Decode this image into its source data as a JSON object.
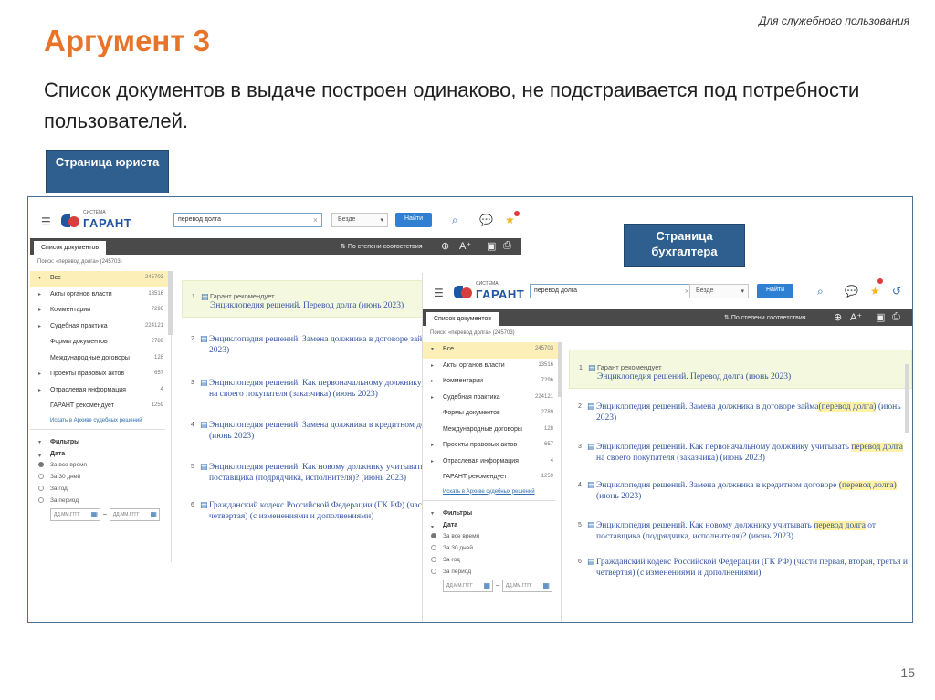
{
  "slide": {
    "confidential": "Для служебного пользования",
    "title": "Аргумент 3",
    "text": "Список документов в выдаче построен одинаково, не подстраивается под потребности пользователей.",
    "page_number": "15"
  },
  "labels": {
    "lawyer": "Страница юриста",
    "accountant": "Страница бухгалтера"
  },
  "app": {
    "logo_sub": "СИСТЕМА",
    "logo_text": "ГАРАНТ",
    "search_value": "перевод долга",
    "scope": "Везде",
    "find_button": "Найти",
    "tab": "Список документов",
    "sort": "По степени соответствия",
    "query": "Поиск: «перевод долга» (245703)",
    "icons": {
      "menu": "hamburger-icon",
      "search": "search-list-icon",
      "chat": "chat-icon",
      "favorite": "star-icon",
      "history": "history-icon",
      "zoom": "zoom-icon",
      "font": "font-size-icon",
      "save": "save-icon",
      "print": "print-icon"
    }
  },
  "sidebar": {
    "items": [
      {
        "label": "Все",
        "count": "245703",
        "selected": true,
        "caret": "▾"
      },
      {
        "label": "Акты органов власти",
        "count": "13516",
        "caret": "▸"
      },
      {
        "label": "Комментарии",
        "count": "7296",
        "caret": "▸"
      },
      {
        "label": "Судебная практика",
        "count": "224121",
        "caret": "▸"
      },
      {
        "label": "Формы документов",
        "count": "2789",
        "caret": ""
      },
      {
        "label": "Международные договоры",
        "count": "128",
        "caret": ""
      },
      {
        "label": "Проекты правовых актов",
        "count": "657",
        "caret": "▸"
      },
      {
        "label": "Отраслевая информация",
        "count": "4",
        "caret": "▸"
      },
      {
        "label": "ГАРАНТ рекомендует",
        "count": "1259",
        "caret": ""
      }
    ],
    "archive_link": "Искать в Архиве судебных решений",
    "filters": "Фильтры",
    "date": "Дата",
    "date_options": [
      "За все время",
      "За 30 дней",
      "За год",
      "За период"
    ],
    "date_placeholder": "ДД.ММ.ГГГГ"
  },
  "results": [
    {
      "n": "1",
      "recommend": "Гарант рекомендует",
      "title": [
        "Энциклопедия решений. Перевод долга (июнь 2023)"
      ]
    },
    {
      "n": "2",
      "title": [
        "Энциклопедия решений. Замена должника в договоре займа",
        {
          "hl": "(перевод долга)"
        },
        " (июнь 2023)"
      ]
    },
    {
      "n": "3",
      "title": [
        "Энциклопедия решений. Как первоначальному должнику учитывать ",
        {
          "hl": "перевод долга"
        },
        " на своего покупателя (заказчика) (июнь 2023)"
      ]
    },
    {
      "n": "4",
      "title": [
        "Энциклопедия решений. Замена должника в кредитном договоре ",
        {
          "hl": "(перевод долга)"
        },
        " (июнь 2023)"
      ]
    },
    {
      "n": "5",
      "title": [
        "Энциклопедия решений. Как новому должнику учитывать ",
        {
          "hl": "перевод долга"
        },
        " от поставщика (подрядчика, исполнителя)? (июнь 2023)"
      ]
    },
    {
      "n": "6",
      "title": [
        "Гражданский кодекс Российской Федерации (ГК РФ) (части первая, вторая, третья и четвертая) (с изменениями и дополнениями)"
      ]
    }
  ],
  "colors": {
    "title_accent": "#e8742a",
    "label_bg": "#2f5f8f",
    "highlight": "#fff2a6",
    "link": "#3657a3"
  }
}
